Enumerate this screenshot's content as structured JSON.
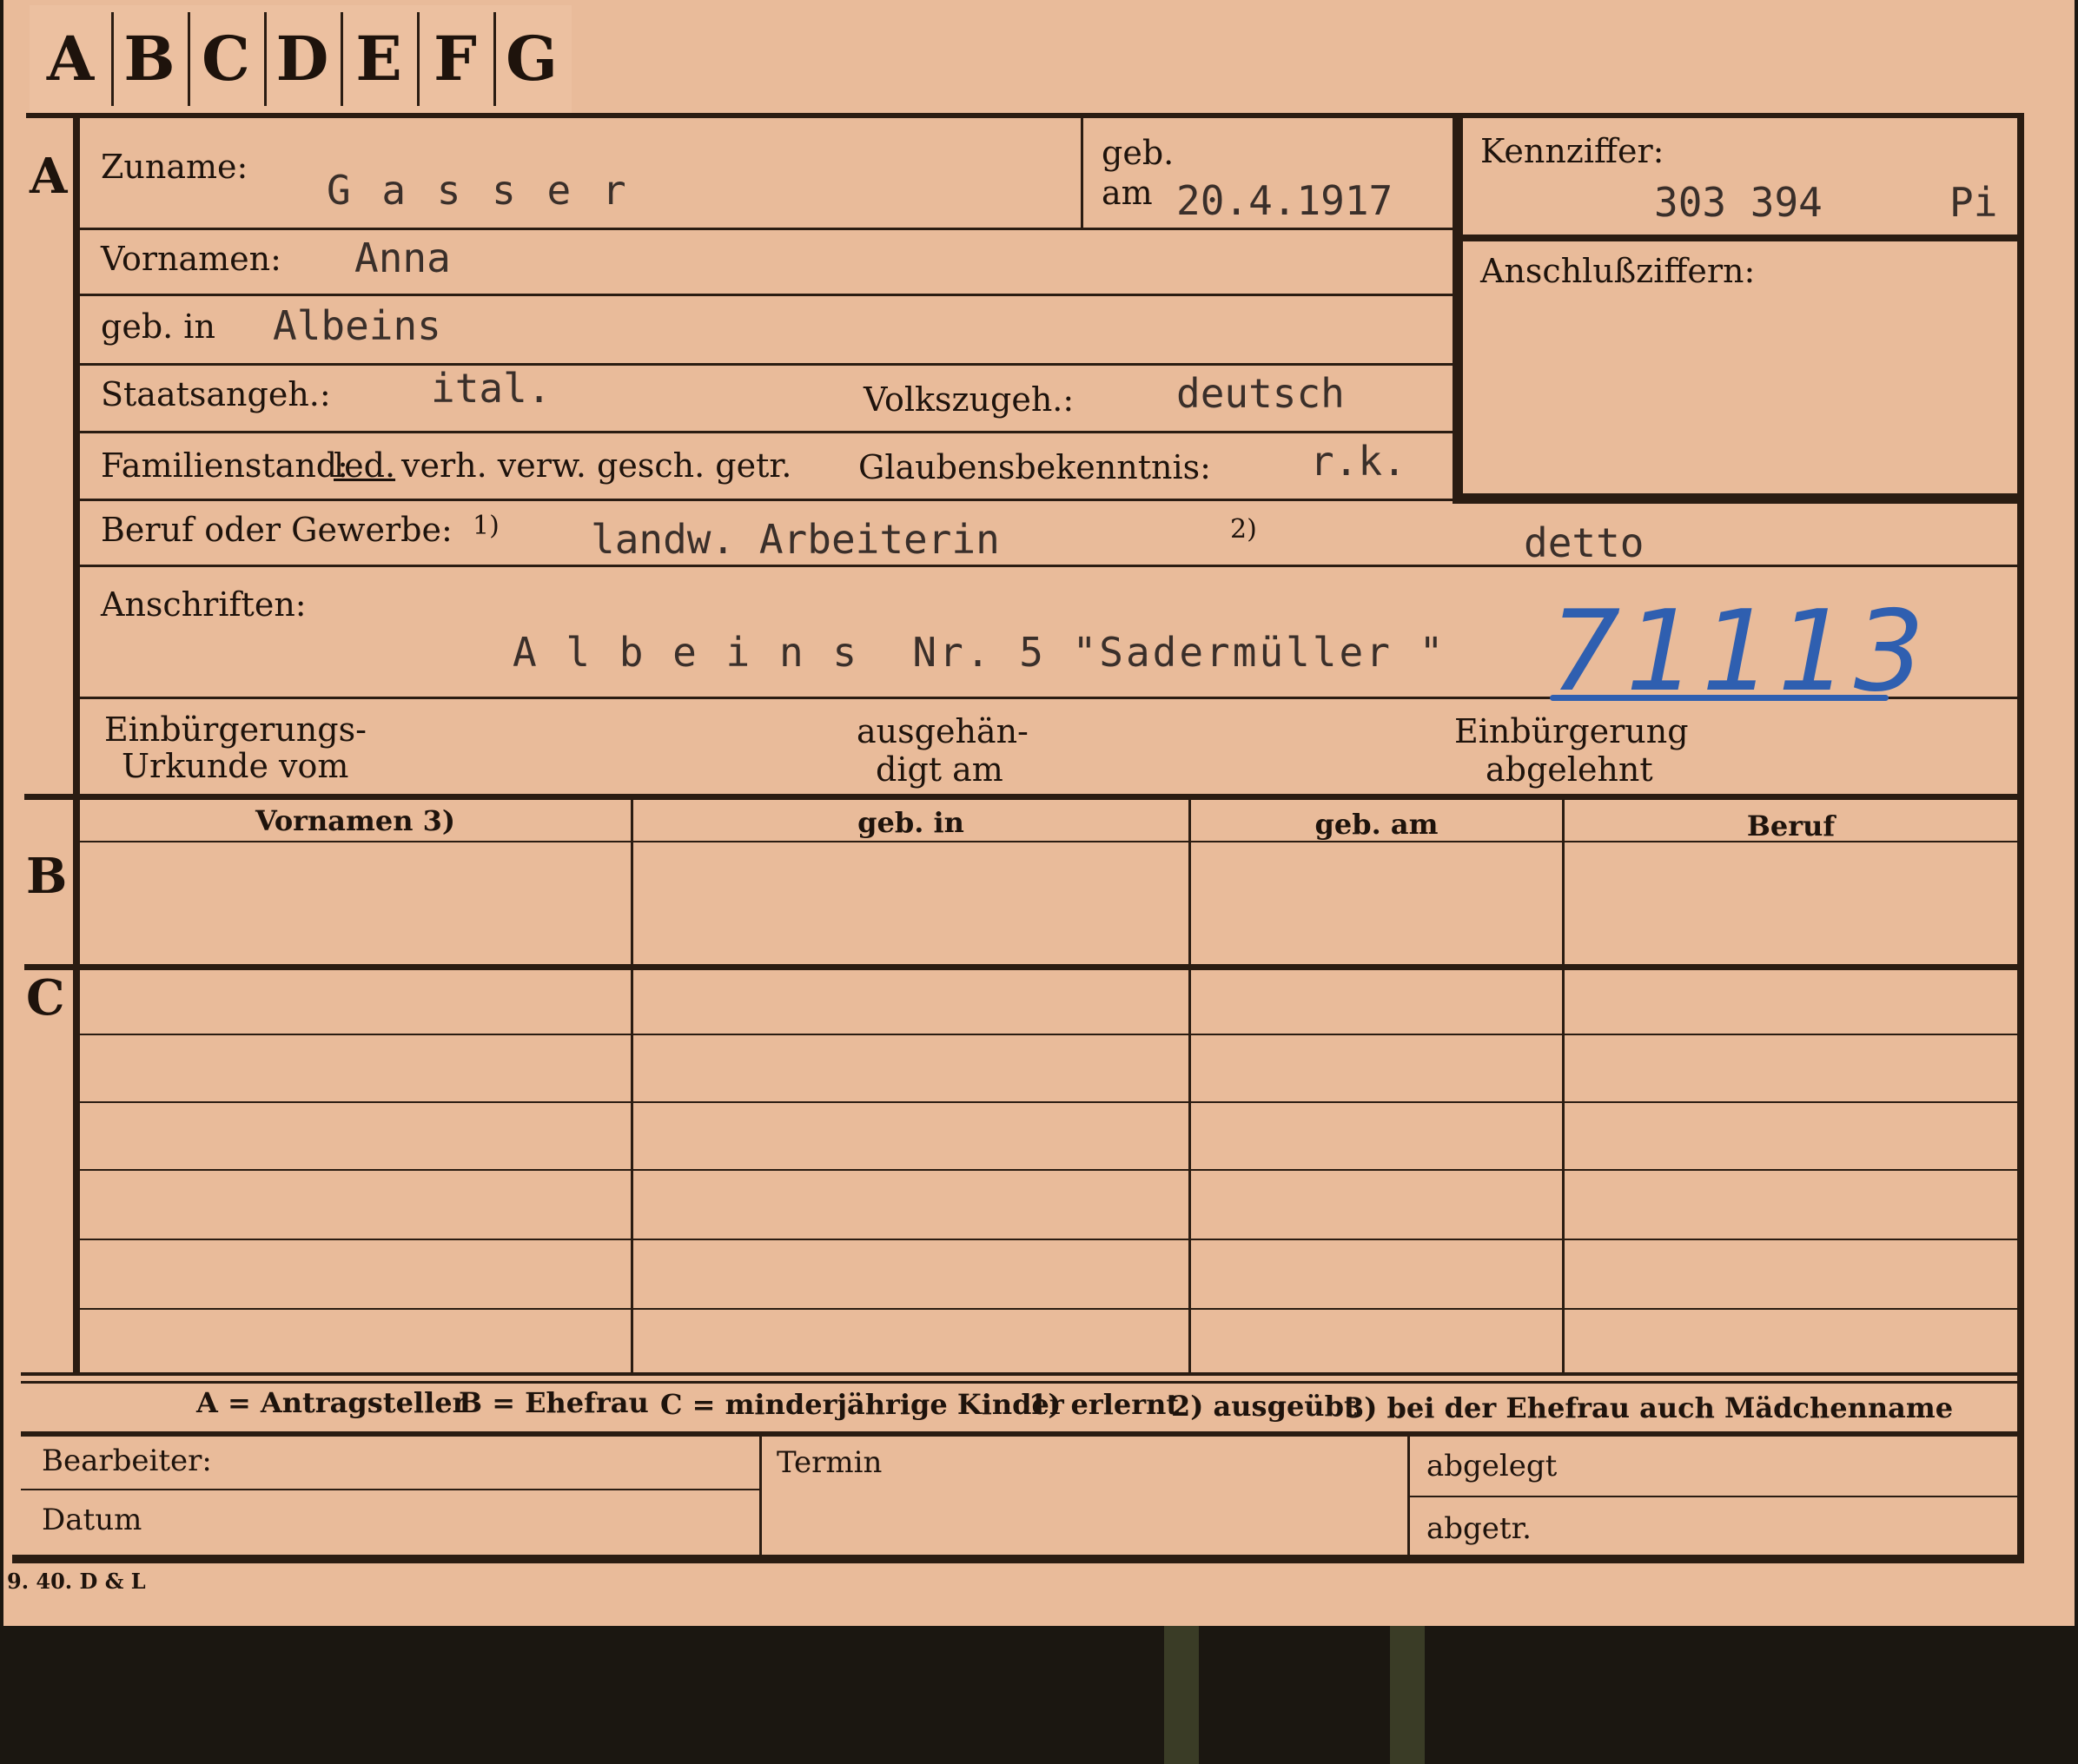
{
  "tabs": [
    "A",
    "B",
    "C",
    "D",
    "E",
    "F",
    "G"
  ],
  "section_a": {
    "letter": "A",
    "zuname_label": "Zuname:",
    "zuname_value": "G a s s e r",
    "geb_label": "geb.",
    "am_label": "am",
    "geb_date": "20.4.1917",
    "kennziffer_label": "Kennziffer:",
    "kennziffer_value": "303 394",
    "kennziffer_suffix": "Pi",
    "anschluss_label": "Anschlußziffern:",
    "vornamen_label": "Vornamen:",
    "vornamen_value": "Anna",
    "gebin_label": "geb. in",
    "gebin_value": "Albeins",
    "staat_label": "Staatsangeh.:",
    "staat_value": "ital.",
    "volks_label": "Volkszugeh.:",
    "volks_value": "deutsch",
    "familien_label_prefix": "Familienstand:",
    "familien_selected": "led.",
    "familien_rest": "verh. verw. gesch. getr.",
    "glaube_label": "Glaubensbekenntnis:",
    "glaube_value": "r.k.",
    "beruf_label": "Beruf oder Gewerbe:",
    "beruf_fn1": "1)",
    "beruf_value1": "landw. Arbeiterin",
    "beruf_fn2": "2)",
    "beruf_value2": "detto",
    "anschriften_label": "Anschriften:",
    "anschrift_value": "A l b e i n s  Nr. 5 \"Sadermüller \"",
    "handwritten_number": "71113",
    "einb_label_1": "Einbürgerungs-",
    "einb_label_2": "Urkunde vom",
    "ausgeh_label_1": "ausgehän-",
    "ausgeh_label_2": "digt am",
    "abgelehnt_label_1": "Einbürgerung",
    "abgelehnt_label_2": "abgelehnt"
  },
  "section_b": {
    "letter": "B",
    "columns": [
      "Vornamen 3)",
      "geb. in",
      "geb. am",
      "Beruf"
    ]
  },
  "section_c": {
    "letter": "C"
  },
  "legend": {
    "a": "A = Antragsteller",
    "b": "B = Ehefrau",
    "c": "C = minderjährige Kinder",
    "f1": "1) erlernt",
    "f2": "2) ausgeübt",
    "f3": "3) bei der Ehefrau auch Mädchenname"
  },
  "footer": {
    "bearbeiter": "Bearbeiter:",
    "datum": "Datum",
    "termin": "Termin",
    "abgelegt": "abgelegt",
    "abgetr": "abgetr."
  },
  "print_note": "9. 40. D & L",
  "colors": {
    "card": "#e9bb9a",
    "ink": "#1e130c",
    "typewriter": "#3a2f2a",
    "handwriting_blue": "#2f5fb0"
  }
}
